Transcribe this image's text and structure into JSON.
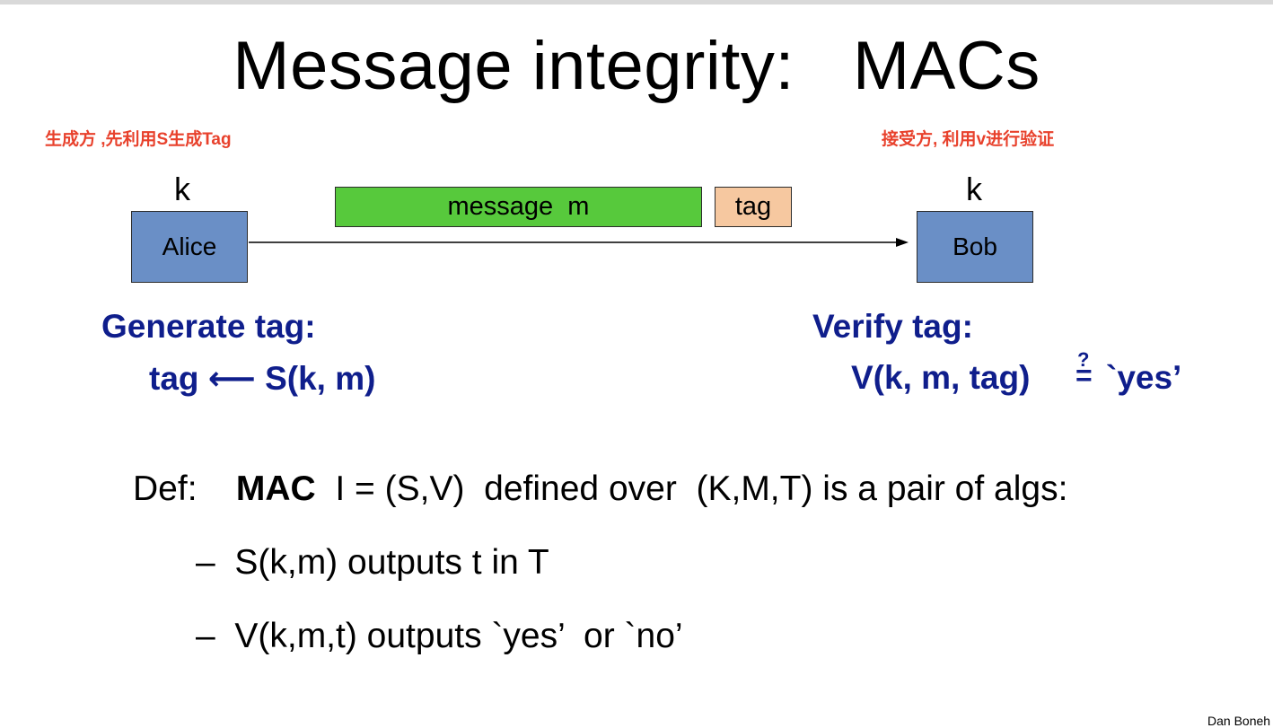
{
  "slide": {
    "title": "Message integrity:   MACs",
    "notes": {
      "left": "生成方 ,先利用S生成Tag",
      "right": "接受方, 利用v进行验证"
    },
    "diagram": {
      "key_left": "k",
      "key_right": "k",
      "sender": "Alice",
      "receiver": "Bob",
      "message": "message  m",
      "tag": "tag"
    },
    "generate": {
      "heading": "Generate tag:",
      "formula": "tag ⟵ S(k, m)"
    },
    "verify": {
      "heading": "Verify tag:",
      "formula": "V(k, m, tag)",
      "question_mark": "?",
      "equals": "=",
      "result": "`yes’"
    },
    "definition": {
      "prefix": "Def:    ",
      "mac_word": "MAC",
      "rest": "  I = (S,V)  defined over  (K,M,T) is a pair of algs:"
    },
    "bullets": [
      "–  S(k,m) outputs t in T",
      "–  V(k,m,t) outputs `yes’  or `no’"
    ],
    "credit": "Dan Boneh"
  }
}
